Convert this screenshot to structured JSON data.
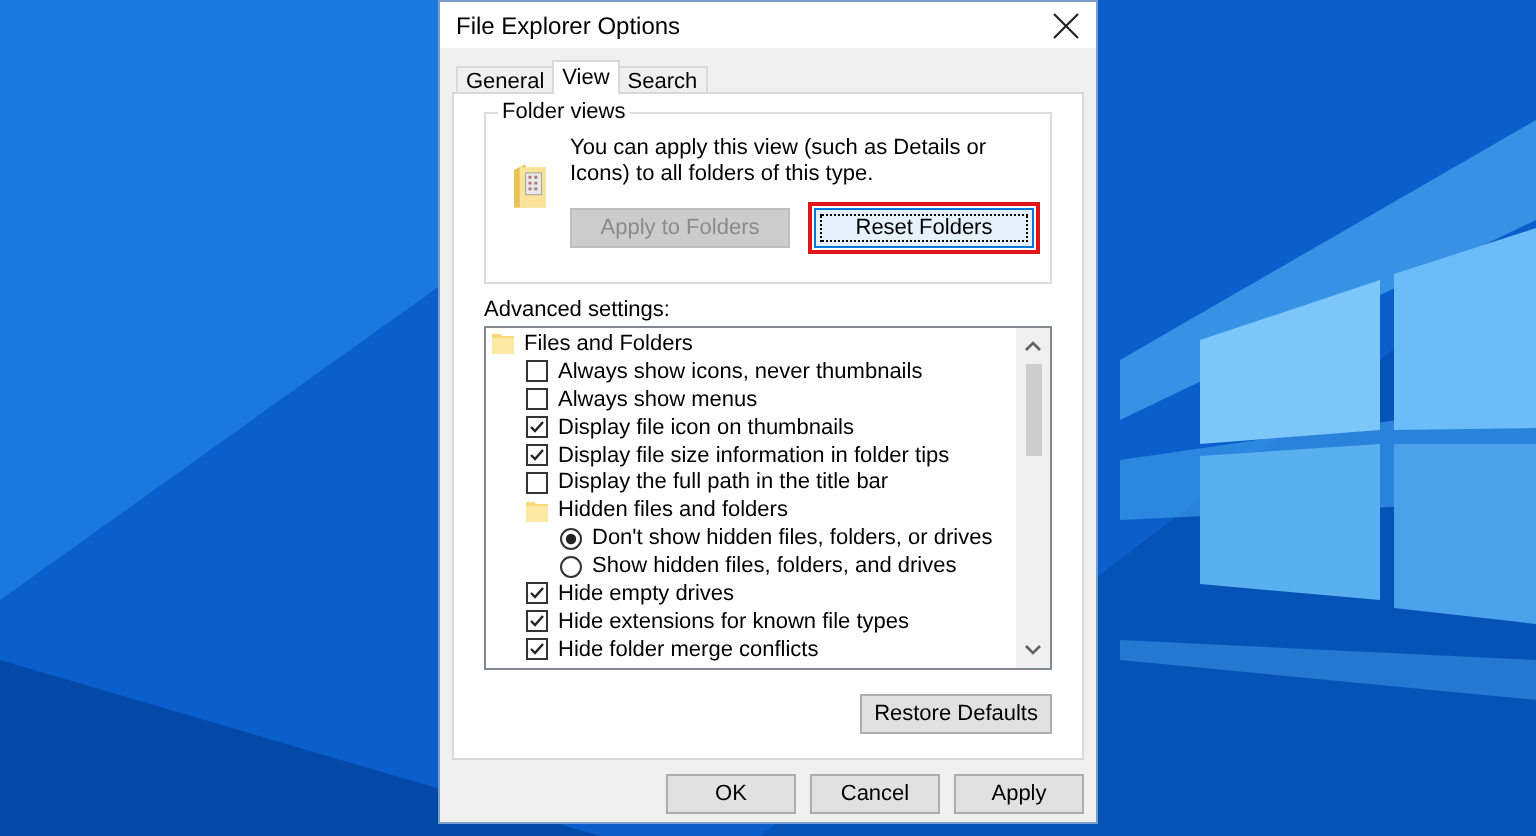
{
  "window": {
    "title": "File Explorer Options"
  },
  "tabs": [
    {
      "label": "General",
      "selected": false
    },
    {
      "label": "View",
      "selected": true
    },
    {
      "label": "Search",
      "selected": false
    }
  ],
  "folder_views": {
    "title": "Folder views",
    "description": "You can apply this view (such as Details or Icons) to all folders of this type.",
    "buttons": [
      {
        "label": "Apply to Folders",
        "disabled": true,
        "highlighted": false
      },
      {
        "label": "Reset Folders",
        "disabled": false,
        "highlighted": true
      }
    ]
  },
  "advanced_settings": {
    "label": "Advanced settings:",
    "items": [
      {
        "kind": "folder",
        "label": "Files and Folders",
        "children": [
          {
            "kind": "checkbox",
            "label": "Always show icons, never thumbnails",
            "checked": false
          },
          {
            "kind": "checkbox",
            "label": "Always show menus",
            "checked": false
          },
          {
            "kind": "checkbox",
            "label": "Display file icon on thumbnails",
            "checked": true
          },
          {
            "kind": "checkbox",
            "label": "Display file size information in folder tips",
            "checked": true
          },
          {
            "kind": "checkbox",
            "label": "Display the full path in the title bar",
            "checked": false
          },
          {
            "kind": "folder",
            "label": "Hidden files and folders",
            "children": [
              {
                "kind": "radio",
                "label": "Don't show hidden files, folders, or drives",
                "selected": true
              },
              {
                "kind": "radio",
                "label": "Show hidden files, folders, and drives",
                "selected": false
              }
            ]
          },
          {
            "kind": "checkbox",
            "label": "Hide empty drives",
            "checked": true
          },
          {
            "kind": "checkbox",
            "label": "Hide extensions for known file types",
            "checked": true
          },
          {
            "kind": "checkbox",
            "label": "Hide folder merge conflicts",
            "checked": true
          }
        ]
      }
    ]
  },
  "restore_button": "Restore Defaults",
  "buttons": [
    "OK",
    "Cancel",
    "Apply"
  ]
}
